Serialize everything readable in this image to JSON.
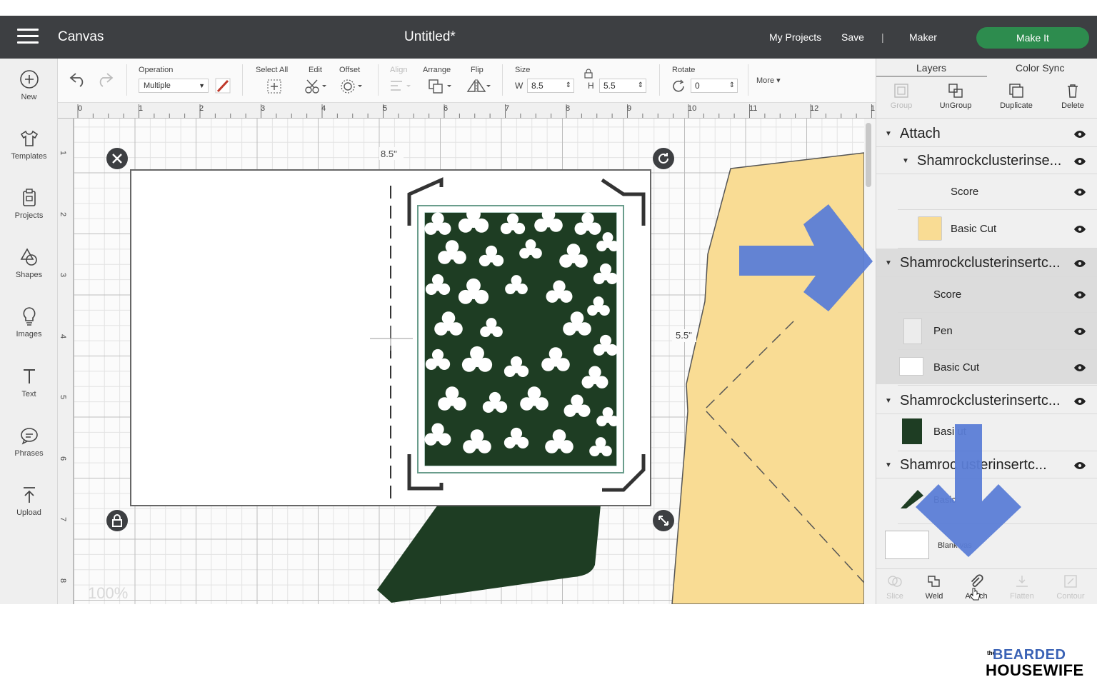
{
  "header": {
    "app_title": "Canvas",
    "doc_title": "Untitled*",
    "my_projects": "My Projects",
    "save": "Save",
    "divider": "|",
    "machine": "Maker",
    "make_it": "Make It",
    "accent_color": "#2d8c4e",
    "bar_color": "#3d3f42"
  },
  "sidebar": {
    "items": [
      {
        "label": "New",
        "icon": "plus-circle-icon"
      },
      {
        "label": "Templates",
        "icon": "shirt-icon"
      },
      {
        "label": "Projects",
        "icon": "projects-icon"
      },
      {
        "label": "Shapes",
        "icon": "shapes-icon"
      },
      {
        "label": "Images",
        "icon": "lightbulb-icon"
      },
      {
        "label": "Text",
        "icon": "text-icon"
      },
      {
        "label": "Phrases",
        "icon": "speech-bubble-icon"
      },
      {
        "label": "Upload",
        "icon": "upload-icon"
      }
    ]
  },
  "toolbar": {
    "operation_label": "Operation",
    "operation_value": "Multiple",
    "select_all": "Select All",
    "edit": "Edit",
    "offset": "Offset",
    "align": "Align",
    "arrange": "Arrange",
    "flip": "Flip",
    "size": "Size",
    "w_label": "W",
    "w_value": "8.5",
    "h_label": "H",
    "h_value": "5.5",
    "rotate": "Rotate",
    "rotate_value": "0",
    "more": "More ▾"
  },
  "ruler": {
    "top": [
      "0",
      "1",
      "2",
      "3",
      "4",
      "5",
      "6",
      "7",
      "8",
      "9",
      "10",
      "11",
      "12",
      "1"
    ],
    "left": [
      "1",
      "2",
      "3",
      "4",
      "5",
      "6",
      "7",
      "8"
    ]
  },
  "canvas": {
    "width_label": "8.5\"",
    "height_label": "5.5\"",
    "zoom": "100%",
    "dark_green": "#1e3d23",
    "yellow": "#f9dc94"
  },
  "panel": {
    "tabs": [
      "Layers",
      "Color Sync"
    ],
    "tools": [
      "Group",
      "UnGroup",
      "Duplicate",
      "Delete"
    ],
    "layers": {
      "attach": "Attach",
      "group1": "Shamrockclusterinse...",
      "score1": "Score",
      "basic_cut1": "Basic Cut",
      "group2": "Shamrockclusterinsertc...",
      "score2": "Score",
      "pen": "Pen",
      "basic_cut2": "Basic Cut",
      "group3": "Shamrockclusterinsertc...",
      "basic_cut3": "Basi    ut",
      "group4": "Shamroc    usterinsertc...",
      "basic4": "Basic",
      "blank_canvas": "Blank     vas"
    },
    "bottom_tools": [
      "Slice",
      "Weld",
      "Attach",
      "Flatten",
      "Contour"
    ],
    "arrow_color": "#5b7dd6"
  },
  "logo": {
    "the": "the",
    "top": "BEARDED",
    "bottom": "HOUSEWIFE"
  }
}
